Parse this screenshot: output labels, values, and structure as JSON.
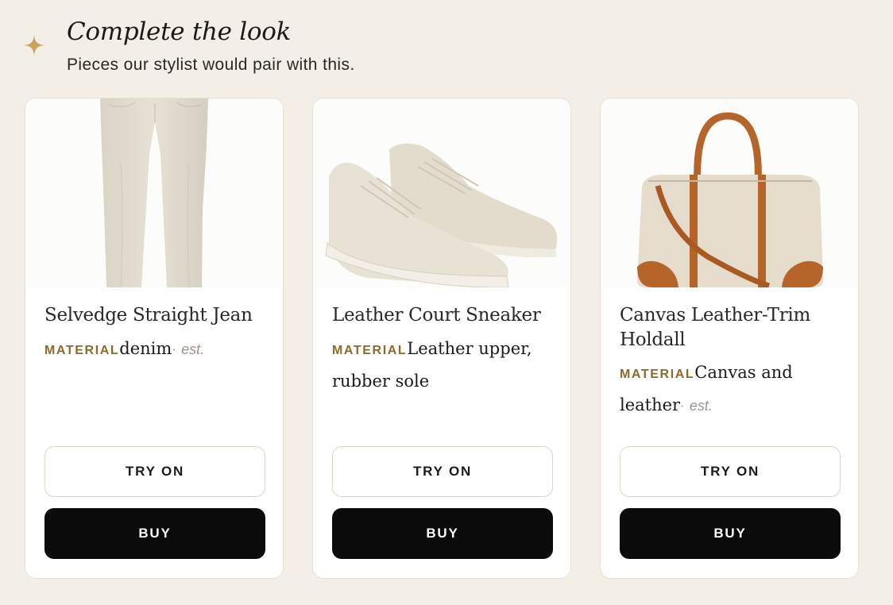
{
  "header": {
    "title": "Complete the look",
    "subtitle": "Pieces our stylist would pair with this.",
    "icon": "sparkle-icon",
    "accent_color": "#c9a25c"
  },
  "products": [
    {
      "name": "Selvedge Straight Jean",
      "material_label": "MATERIAL",
      "material": "denim",
      "separator": "·",
      "est": "est.",
      "try_on_label": "TRY ON",
      "buy_label": "BUY"
    },
    {
      "name": "Leather Court Sneaker",
      "material_label": "MATERIAL",
      "material": "Leather upper, rubber sole",
      "try_on_label": "TRY ON",
      "buy_label": "BUY"
    },
    {
      "name": "Canvas Leather-Trim Holdall",
      "material_label": "MATERIAL",
      "material": "Canvas and leather",
      "separator": "·",
      "est": "est.",
      "try_on_label": "TRY ON",
      "buy_label": "BUY"
    }
  ],
  "colors": {
    "background": "#f3efe6",
    "material_label": "#8b6a2a",
    "buy_button": "#0b0b0b"
  }
}
